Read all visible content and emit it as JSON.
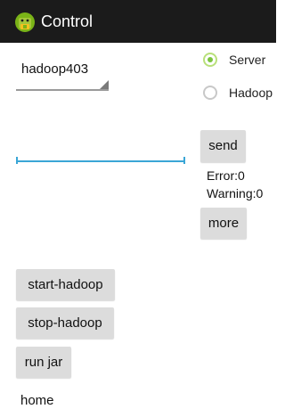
{
  "app": {
    "title": "Control",
    "icon": "android-icon"
  },
  "spinner": {
    "selected": "hadoop403"
  },
  "radios": [
    {
      "label": "Server",
      "checked": true
    },
    {
      "label": "Hadoop",
      "checked": false
    }
  ],
  "input": {
    "value": "",
    "placeholder": ""
  },
  "send_label": "send",
  "status": {
    "error": "Error:0",
    "warning": "Warning:0"
  },
  "more_label": "more",
  "actions": {
    "start_label": "start-hadoop",
    "stop_label": "stop-hadoop",
    "runjar_label": "run jar"
  },
  "footer": {
    "home": "home"
  },
  "colors": {
    "actionbar": "#1b1b1b",
    "accent": "#3aa6d6",
    "radio_on": "#7bc43e",
    "button": "#dcdcdc"
  }
}
